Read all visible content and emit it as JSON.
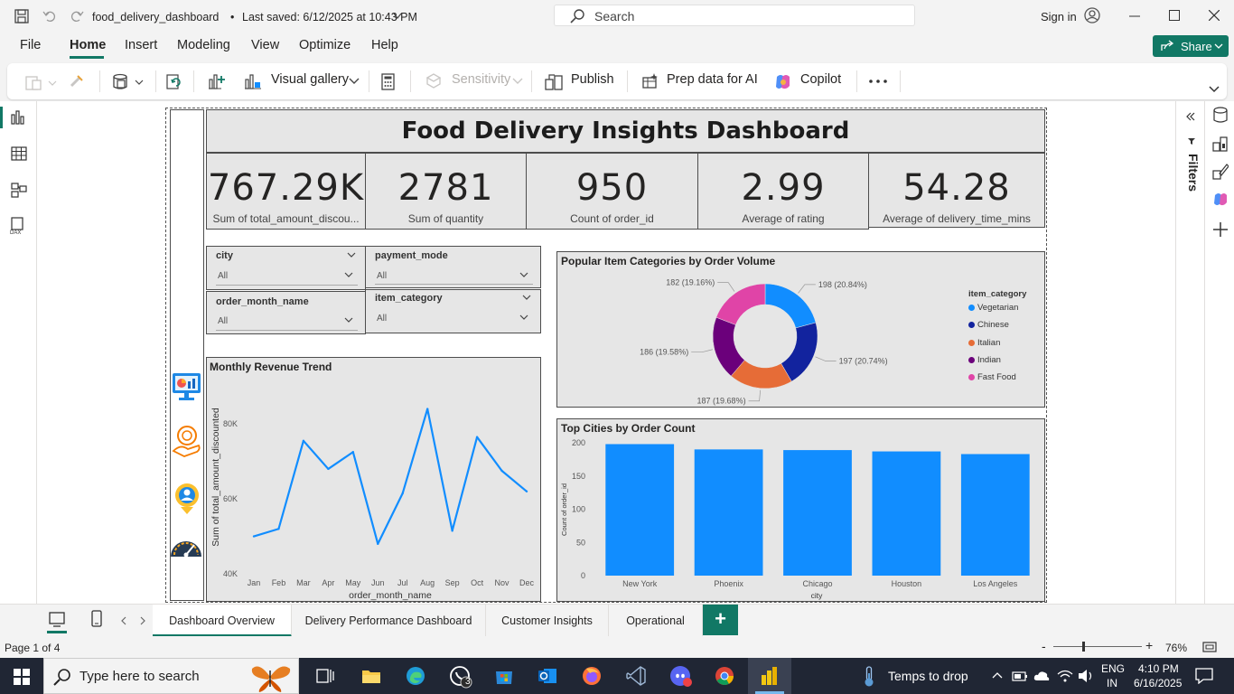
{
  "window": {
    "file_title": "food_delivery_dashboard",
    "saved_status": "Last saved: 6/12/2025 at 10:43 PM",
    "search_placeholder": "Search",
    "sign_in": "Sign in"
  },
  "menu": {
    "file": "File",
    "home": "Home",
    "insert": "Insert",
    "modeling": "Modeling",
    "view": "View",
    "optimize": "Optimize",
    "help": "Help",
    "share": "Share"
  },
  "ribbon": {
    "visual_gallery": "Visual gallery",
    "sensitivity": "Sensitivity",
    "publish": "Publish",
    "prep_data": "Prep data for AI",
    "copilot": "Copilot"
  },
  "filters_label": "Filters",
  "dashboard": {
    "title": "Food Delivery Insights Dashboard",
    "kpis": [
      {
        "value": "767.29K",
        "label": "Sum of total_amount_discou..."
      },
      {
        "value": "2781",
        "label": "Sum of quantity"
      },
      {
        "value": "950",
        "label": "Count of order_id"
      },
      {
        "value": "2.99",
        "label": "Average of rating"
      },
      {
        "value": "54.28",
        "label": "Average of delivery_time_mins"
      }
    ],
    "slicers": [
      {
        "title": "city",
        "value": "All"
      },
      {
        "title": "payment_mode",
        "value": "All"
      },
      {
        "title": "order_month_name",
        "value": "All"
      },
      {
        "title": "item_category",
        "value": "All"
      }
    ]
  },
  "chart_data": [
    {
      "type": "pie",
      "title": "Popular Item Categories by Order Volume",
      "legend_title": "item_category",
      "legend_position": "right",
      "categories": [
        "Vegetarian",
        "Chinese",
        "Italian",
        "Indian",
        "Fast Food"
      ],
      "values": [
        198,
        197,
        187,
        186,
        182
      ],
      "labels": [
        "198 (20.84%)",
        "197 (20.74%)",
        "187 (19.68%)",
        "186 (19.58%)",
        "182 (19.16%)"
      ],
      "colors": [
        "#118dff",
        "#12239e",
        "#e66c37",
        "#6b007b",
        "#e044a7"
      ]
    },
    {
      "type": "line",
      "title": "Monthly Revenue Trend",
      "xlabel": "order_month_name",
      "ylabel": "Sum of total_amount_discounted",
      "categories": [
        "Jan",
        "Feb",
        "Mar",
        "Apr",
        "May",
        "Jun",
        "Jul",
        "Aug",
        "Sep",
        "Oct",
        "Nov",
        "Dec"
      ],
      "values": [
        50000,
        52000,
        75500,
        68000,
        72500,
        48000,
        61500,
        84000,
        51500,
        76500,
        67500,
        62000
      ],
      "ylim": [
        40000,
        88000
      ],
      "yticks": [
        {
          "v": 40000,
          "t": "40K"
        },
        {
          "v": 60000,
          "t": "60K"
        },
        {
          "v": 80000,
          "t": "80K"
        }
      ],
      "color": "#118dff"
    },
    {
      "type": "bar",
      "title": "Top Cities by Order Count",
      "xlabel": "city",
      "ylabel": "Count of order_id",
      "categories": [
        "New York",
        "Phoenix",
        "Chicago",
        "Houston",
        "Los Angeles"
      ],
      "values": [
        198,
        190,
        189,
        187,
        183
      ],
      "ylim": [
        0,
        200
      ],
      "yticks": [
        0,
        50,
        100,
        150,
        200
      ],
      "color": "#118dff"
    }
  ],
  "pages": [
    "Dashboard Overview",
    "Delivery Performance Dashboard",
    "Customer Insights",
    "Operational"
  ],
  "status": {
    "page_info": "Page 1 of 4",
    "zoom": "76%"
  },
  "taskbar": {
    "search_placeholder": "Type here to search",
    "weather": "Temps to drop",
    "lang": "ENG",
    "region": "IN",
    "time": "4:10 PM",
    "date": "6/16/2025",
    "whatsapp_badge": "3"
  }
}
